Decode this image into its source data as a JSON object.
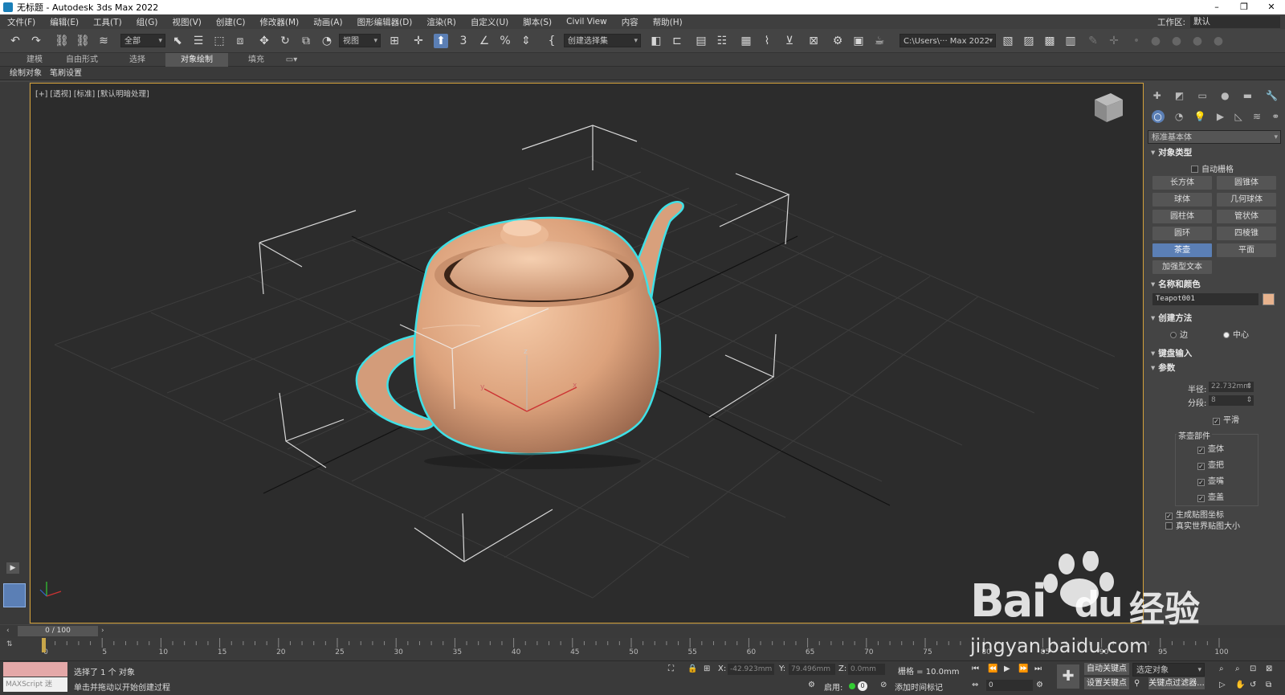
{
  "titlebar": {
    "title": "无标题 - Autodesk 3ds Max 2022",
    "minimize_icon": "minimize-icon",
    "restore_icon": "restore-icon",
    "close_icon": "close-icon"
  },
  "menu": [
    "文件(F)",
    "编辑(E)",
    "工具(T)",
    "组(G)",
    "视图(V)",
    "创建(C)",
    "修改器(M)",
    "动画(A)",
    "图形编辑器(D)",
    "渲染(R)",
    "自定义(U)",
    "脚本(S)",
    "Civil View",
    "内容",
    "帮助(H)"
  ],
  "workspace": {
    "label": "工作区:",
    "value": "默认"
  },
  "toolbar": {
    "filter_select": "全部",
    "ref_coord_select": "视图",
    "named_selection": "创建选择集",
    "project_path": "C:\\Users\\··· Max 2022"
  },
  "ribbon_tabs": [
    {
      "label": "建模",
      "active": false
    },
    {
      "label": "自由形式",
      "active": false
    },
    {
      "label": "选择",
      "active": false
    },
    {
      "label": "对象绘制",
      "active": true
    },
    {
      "label": "填充",
      "active": false
    }
  ],
  "sub_tabs": [
    "绘制对象",
    "笔刷设置"
  ],
  "viewport": {
    "label": "[+] [透视] [标准] [默认明暗处理]",
    "axis_z": "z",
    "axis_x": "x",
    "axis_y": "y"
  },
  "panel": {
    "category_select": "标准基本体",
    "object_type": {
      "title": "对象类型",
      "autogrid": "自动栅格",
      "buttons": [
        {
          "label": "长方体",
          "active": false
        },
        {
          "label": "圆锥体",
          "active": false
        },
        {
          "label": "球体",
          "active": false
        },
        {
          "label": "几何球体",
          "active": false
        },
        {
          "label": "圆柱体",
          "active": false
        },
        {
          "label": "管状体",
          "active": false
        },
        {
          "label": "圆环",
          "active": false
        },
        {
          "label": "四棱锥",
          "active": false
        },
        {
          "label": "茶壶",
          "active": true
        },
        {
          "label": "平面",
          "active": false
        },
        {
          "label": "加强型文本",
          "active": false
        }
      ]
    },
    "name_color": {
      "title": "名称和颜色",
      "name": "Teapot001",
      "color": "#e8b38e"
    },
    "creation_method": {
      "title": "创建方法",
      "edge": "边",
      "center": "中心"
    },
    "keyboard_entry": {
      "title": "键盘输入"
    },
    "parameters": {
      "title": "参数",
      "radius_label": "半径:",
      "radius_value": "22.732mm",
      "segments_label": "分段:",
      "segments_value": "8",
      "smooth": "平滑",
      "parts_title": "茶壶部件",
      "parts": [
        "壶体",
        "壶把",
        "壶嘴",
        "壶盖"
      ],
      "gen_mapping": "生成贴图坐标",
      "real_world": "真实世界贴图大小"
    }
  },
  "timeline": {
    "frame": "0 / 100",
    "ticks": [
      "0",
      "5",
      "10",
      "15",
      "20",
      "25",
      "30",
      "35",
      "40",
      "45",
      "50",
      "55",
      "60",
      "65",
      "70",
      "75",
      "80",
      "85",
      "90",
      "95",
      "100"
    ]
  },
  "status": {
    "maxscript": "MAXScript 迷",
    "selected": "选择了 1 个 对象",
    "hint": "单击并拖动以开始创建过程",
    "x_label": "X:",
    "x_value": "-42.923mm",
    "y_label": "Y:",
    "y_value": "79.496mm",
    "z_label": "Z:",
    "z_value": "0.0mm",
    "grid": "栅格 = 10.0mm",
    "enable": "启用:",
    "add_time_tag": "添加时间标记",
    "auto_key": "自动关键点",
    "set_key": "设置关键点",
    "selected_object": "选定对象",
    "key_filters": "关键点过滤器...",
    "current_frame": "0"
  },
  "watermark": {
    "brand": "Bai",
    "brand2": "du",
    "cn": "经验",
    "url": "jingyan.baidu.com"
  },
  "colors": {
    "accent": "#5b7fb5",
    "teapot": "#e8b38e",
    "outline": "#3fe0e6",
    "viewport_border": "#d4a13a"
  }
}
